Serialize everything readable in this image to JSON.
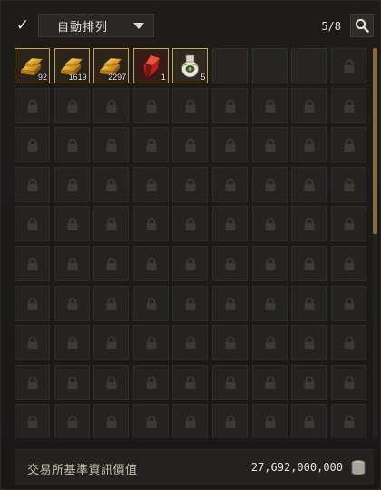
{
  "toolbar": {
    "auto_sort_checked": true,
    "auto_sort_label": "自動排列",
    "slot_count": "5/8",
    "search_icon": "search-icon"
  },
  "inventory": {
    "items": [
      {
        "name": "gold-bar",
        "icon": "gold-bar-icon",
        "quantity": "92"
      },
      {
        "name": "gold-bar",
        "icon": "gold-bar-icon",
        "quantity": "1619"
      },
      {
        "name": "gold-bar",
        "icon": "gold-bar-icon",
        "quantity": "2297"
      },
      {
        "name": "red-crystal",
        "icon": "red-crystal-icon",
        "quantity": "1"
      },
      {
        "name": "ornate-vase",
        "icon": "vase-icon",
        "quantity": "5"
      }
    ],
    "open_slots": 3,
    "columns": 9,
    "rows": 10,
    "locked_icon": "lock-icon",
    "scroll_position": 0.0
  },
  "footer": {
    "label": "交易所基準資訊價值",
    "value": "27,692,000,000",
    "currency_icon": "silver-coin-icon"
  },
  "colors": {
    "item_border": "#c9a352",
    "scroll_thumb": "#8a6a3e"
  }
}
